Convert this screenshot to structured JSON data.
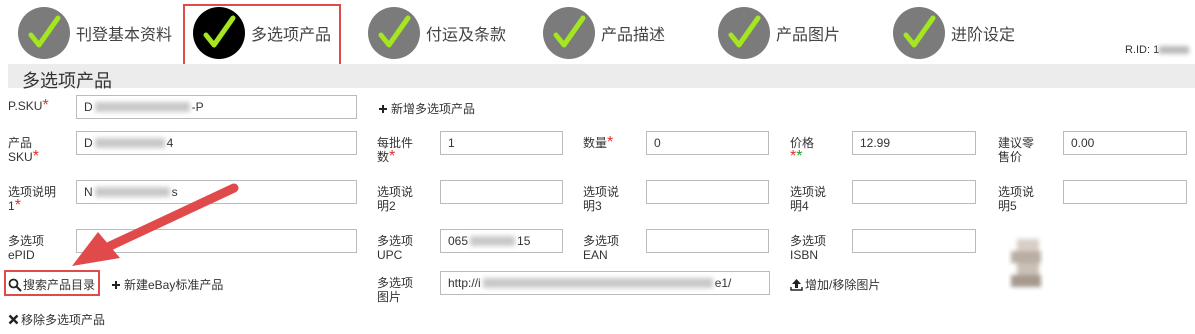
{
  "steps": [
    {
      "label": "刊登基本资料"
    },
    {
      "label": "多选项产品"
    },
    {
      "label": "付运及条款"
    },
    {
      "label": "产品描述"
    },
    {
      "label": "产品图片"
    },
    {
      "label": "进阶设定"
    }
  ],
  "active_step": "多选项产品",
  "rid_label": "R.ID: 1",
  "section_title": "多选项产品",
  "fields": {
    "psku_label": "P.SKU",
    "psku_value_prefix": "D",
    "psku_value_suffix": "-P",
    "add_variation_label": "新增多选项产品",
    "product_sku_label_1": "产品",
    "product_sku_label_2": "SKU",
    "product_sku_prefix": "D",
    "product_sku_suffix": "4",
    "per_batch_label_1": "每批件",
    "per_batch_label_2": "数",
    "per_batch_value": "1",
    "qty_label": "数量",
    "qty_value": "0",
    "price_label": "价格",
    "price_value": "12.99",
    "msrp_label_1": "建议零",
    "msrp_label_2": "售价",
    "msrp_value": "0.00",
    "opt1_label_1": "选项说明",
    "opt1_label_2": "1",
    "opt1_prefix": "N",
    "opt1_suffix": "s",
    "opt2_label_1": "选项说",
    "opt2_label_2": "明2",
    "opt3_label_1": "选项说",
    "opt3_label_2": "明3",
    "opt4_label_1": "选项说",
    "opt4_label_2": "明4",
    "opt5_label_1": "选项说",
    "opt5_label_2": "明5",
    "epid_label_1": "多选项",
    "epid_label_2": "ePID",
    "upc_label_1": "多选项",
    "upc_label_2": "UPC",
    "upc_prefix": "065",
    "upc_suffix": "15",
    "ean_label_1": "多选项",
    "ean_label_2": "EAN",
    "isbn_label_1": "多选项",
    "isbn_label_2": "ISBN",
    "image_label_1": "多选项",
    "image_label_2": "图片",
    "image_url_prefix": "http://i",
    "image_url_suffix": "e1/"
  },
  "actions": {
    "search_catalog": "搜索产品目录",
    "new_ebay_product": "新建eBay标准产品",
    "add_remove_images": "增加/移除图片",
    "remove_variation": "移除多选项产品"
  },
  "colors": {
    "step_circle": "#7b7b7b",
    "step_active": "#000000",
    "check": "#a4e61f",
    "highlight": "#e04a4a",
    "required": "#e03030",
    "required_green": "#2a9a2a"
  },
  "icons": [
    "check-icon",
    "plus-icon",
    "search-icon",
    "upload-icon",
    "close-icon",
    "arrow-annotation"
  ]
}
